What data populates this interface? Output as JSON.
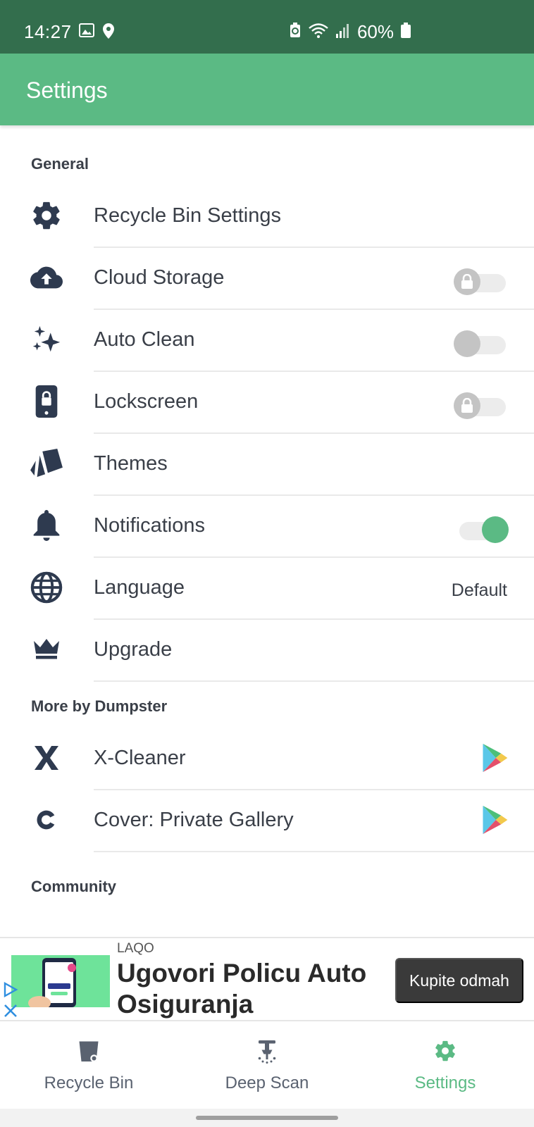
{
  "status_bar": {
    "time": "14:27",
    "battery": "60%",
    "icons": [
      "image-icon",
      "location-icon",
      "battery-saver-icon",
      "wifi-icon",
      "signal-icon",
      "battery-icon"
    ]
  },
  "app_bar": {
    "title": "Settings"
  },
  "sections": {
    "general": "General",
    "more": "More by Dumpster",
    "community": "Community"
  },
  "general_items": [
    {
      "label": "Recycle Bin Settings",
      "icon": "gear-icon"
    },
    {
      "label": "Cloud Storage",
      "icon": "cloud-upload-icon",
      "toggle": "locked-off"
    },
    {
      "label": "Auto Clean",
      "icon": "sparkles-icon",
      "toggle": "off"
    },
    {
      "label": "Lockscreen",
      "icon": "phone-lock-icon",
      "toggle": "locked-off"
    },
    {
      "label": "Themes",
      "icon": "swatches-icon"
    },
    {
      "label": "Notifications",
      "icon": "bell-icon",
      "toggle": "on"
    },
    {
      "label": "Language",
      "icon": "globe-icon",
      "value": "Default"
    },
    {
      "label": "Upgrade",
      "icon": "crown-icon"
    }
  ],
  "more_items": [
    {
      "label": "X-Cleaner",
      "icon": "x-icon"
    },
    {
      "label": "Cover: Private Gallery",
      "icon": "c-icon"
    }
  ],
  "ad": {
    "brand": "LAQO",
    "headline": "Ugovori Policu Auto Osiguranja",
    "cta": "Kupite odmah"
  },
  "bottom_nav": {
    "items": [
      {
        "label": "Recycle Bin",
        "icon": "trash-icon"
      },
      {
        "label": "Deep Scan",
        "icon": "deep-scan-icon"
      },
      {
        "label": "Settings",
        "icon": "gear-icon",
        "active": true
      }
    ]
  },
  "colors": {
    "status_bar": "#336e4d",
    "app_bar": "#5bba84",
    "accent": "#5bba84",
    "icon": "#2e3a4f",
    "text": "#3a3f48"
  }
}
